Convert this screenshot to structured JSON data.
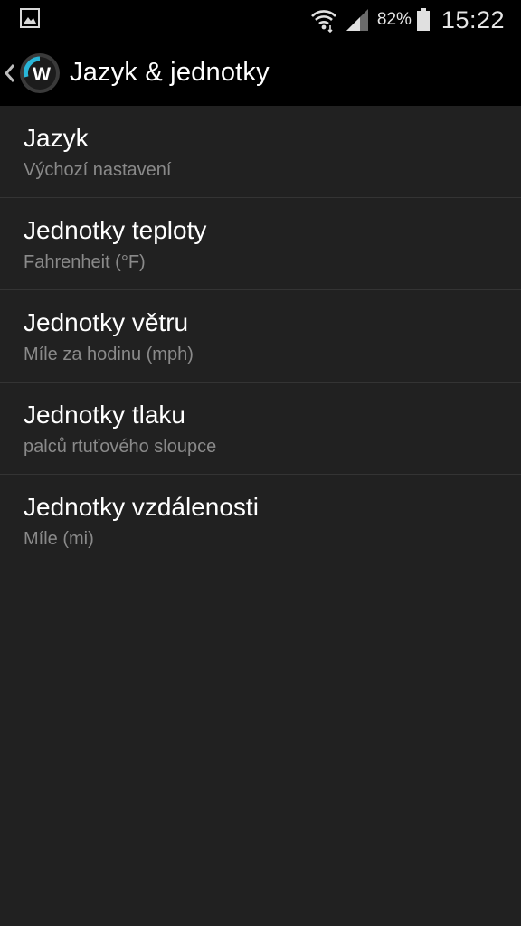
{
  "status_bar": {
    "battery_percent": "82%",
    "time": "15:22"
  },
  "app_bar": {
    "title": "Jazyk & jednotky",
    "logo_text": "W"
  },
  "settings": [
    {
      "title": "Jazyk",
      "value": "Výchozí nastavení"
    },
    {
      "title": "Jednotky teploty",
      "value": "Fahrenheit (°F)"
    },
    {
      "title": "Jednotky větru",
      "value": "Míle za hodinu (mph)"
    },
    {
      "title": "Jednotky tlaku",
      "value": "palců rtuťového sloupce"
    },
    {
      "title": "Jednotky vzdálenosti",
      "value": "Míle (mi)"
    }
  ],
  "colors": {
    "background": "#212121",
    "bars": "#000000",
    "accent": "#29b6d8",
    "title_text": "#ffffff",
    "subtitle_text": "#8a8a8a",
    "divider": "#343434"
  }
}
